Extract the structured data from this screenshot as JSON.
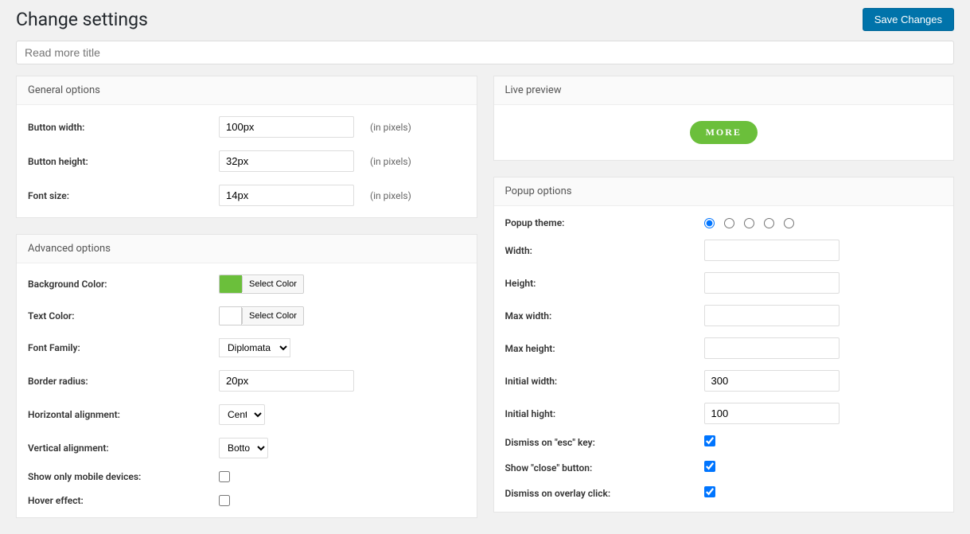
{
  "header": {
    "title": "Change settings",
    "save_button": "Save Changes"
  },
  "title_field": {
    "placeholder": "Read more title"
  },
  "general": {
    "panel_title": "General options",
    "button_width": {
      "label": "Button width:",
      "value": "100px",
      "hint": "(in pixels)"
    },
    "button_height": {
      "label": "Button height:",
      "value": "32px",
      "hint": "(in pixels)"
    },
    "font_size": {
      "label": "Font size:",
      "value": "14px",
      "hint": "(in pixels)"
    }
  },
  "advanced": {
    "panel_title": "Advanced options",
    "bg_color": {
      "label": "Background Color:",
      "button": "Select Color"
    },
    "text_color": {
      "label": "Text Color:",
      "button": "Select Color"
    },
    "font_family": {
      "label": "Font Family:",
      "value": "Diplomata SC"
    },
    "border_radius": {
      "label": "Border radius:",
      "value": "20px"
    },
    "h_align": {
      "label": "Horizontal alignment:",
      "value": "Center"
    },
    "v_align": {
      "label": "Vertical alignment:",
      "value": "Bottom"
    },
    "mobile_only": {
      "label": "Show only mobile devices:"
    },
    "hover_effect": {
      "label": "Hover effect:"
    }
  },
  "preview": {
    "panel_title": "Live preview",
    "button_text": "MORE"
  },
  "popup": {
    "panel_title": "Popup options",
    "theme": {
      "label": "Popup theme:"
    },
    "width": {
      "label": "Width:",
      "value": ""
    },
    "height": {
      "label": "Height:",
      "value": ""
    },
    "max_width": {
      "label": "Max width:",
      "value": ""
    },
    "max_height": {
      "label": "Max height:",
      "value": ""
    },
    "initial_width": {
      "label": "Initial width:",
      "value": "300"
    },
    "initial_height": {
      "label": "Initial hight:",
      "value": "100"
    },
    "dismiss_esc": {
      "label": "Dismiss on \"esc\" key:"
    },
    "show_close": {
      "label": "Show \"close\" button:"
    },
    "dismiss_overlay": {
      "label": "Dismiss on overlay click:"
    }
  }
}
